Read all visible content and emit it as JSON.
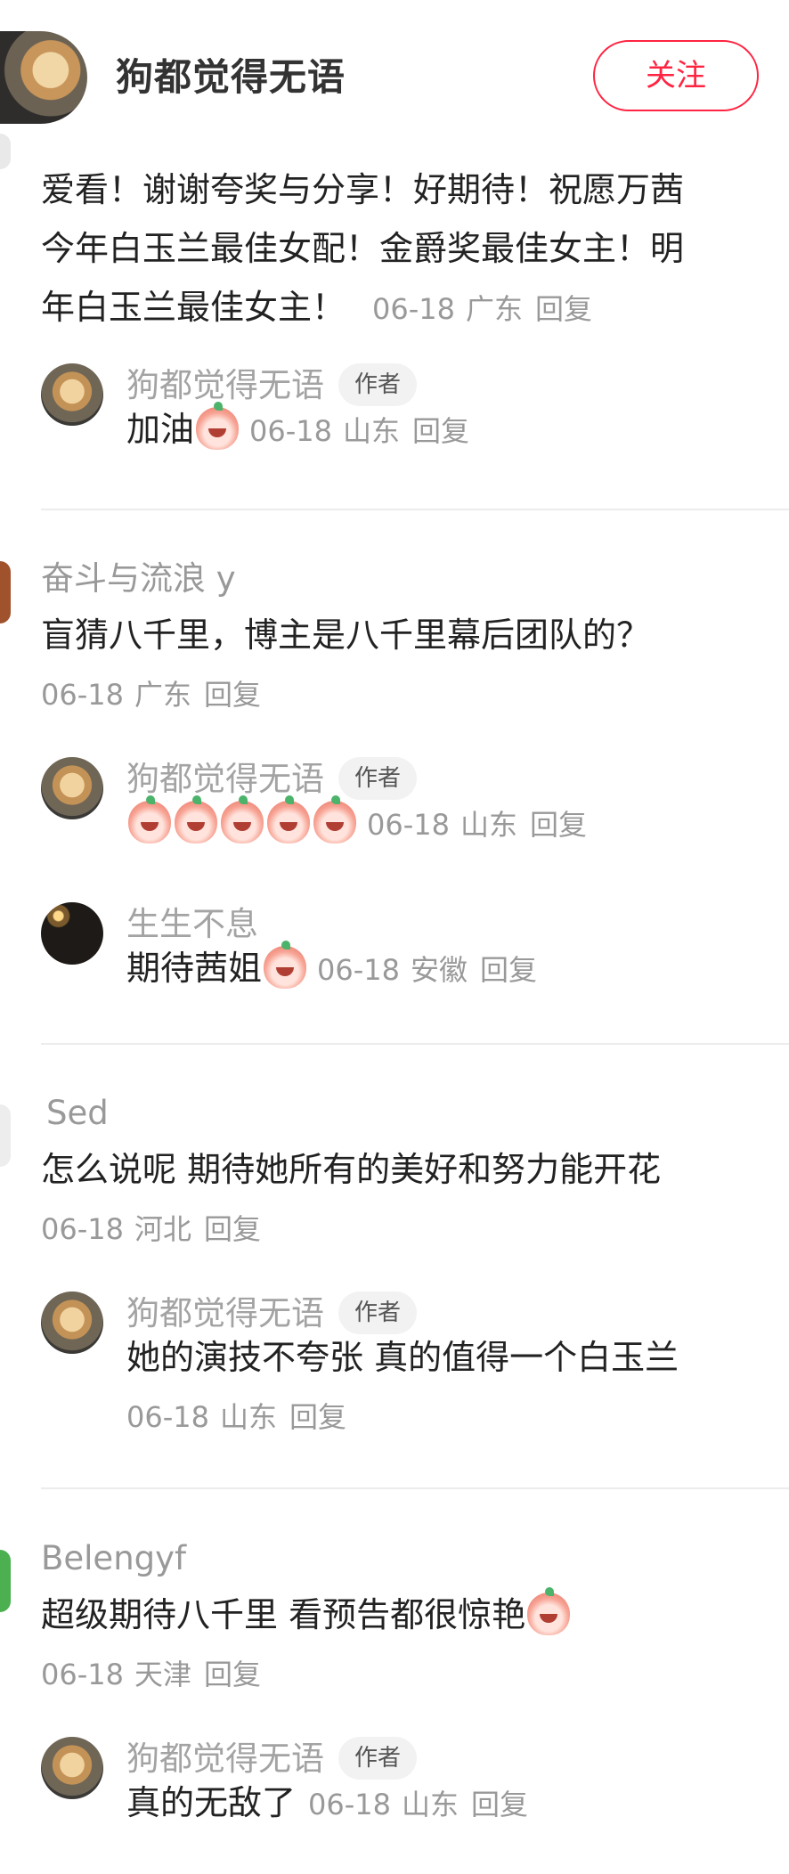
{
  "header": {
    "author_name": "狗都觉得无语",
    "follow_label": "关注"
  },
  "comments": [
    {
      "text": "爱看！谢谢夸奖与分享！好期待！祝愿万茜今年白玉兰最佳女配！金爵奖最佳女主！明年白玉兰最佳女主！",
      "line1": "爱看！谢谢夸奖与分享！好期待！祝愿万茜",
      "line2": "今年白玉兰最佳女配！金爵奖最佳女主！明",
      "line3": "年白玉兰最佳女主！",
      "date": "06-18",
      "location": "广东",
      "reply_label": "回复",
      "replies": [
        {
          "name": "狗都觉得无语",
          "badge": "作者",
          "text": "加油",
          "emoji_count": 1,
          "date": "06-18",
          "location": "山东",
          "reply_label": "回复"
        }
      ]
    },
    {
      "name": "奋斗与流浪 y",
      "text": "盲猜八千里，博主是八千里幕后团队的？",
      "date": "06-18",
      "location": "广东",
      "reply_label": "回复",
      "replies": [
        {
          "name": "狗都觉得无语",
          "badge": "作者",
          "text": "",
          "emoji_count": 5,
          "date": "06-18",
          "location": "山东",
          "reply_label": "回复"
        },
        {
          "name": "生生不息",
          "text": "期待茜姐",
          "emoji_count": 1,
          "date": "06-18",
          "location": "安徽",
          "reply_label": "回复"
        }
      ]
    },
    {
      "name": "Sed",
      "text": "怎么说呢 期待她所有的美好和努力能开花",
      "date": "06-18",
      "location": "河北",
      "reply_label": "回复",
      "replies": [
        {
          "name": "狗都觉得无语",
          "badge": "作者",
          "text": "她的演技不夸张 真的值得一个白玉兰",
          "date": "06-18",
          "location": "山东",
          "reply_label": "回复"
        }
      ]
    },
    {
      "name": "Belengyf",
      "text": "超级期待八千里 看预告都很惊艳",
      "emoji_count": 1,
      "date": "06-18",
      "location": "天津",
      "reply_label": "回复",
      "replies": [
        {
          "name": "狗都觉得无语",
          "badge": "作者",
          "text": "真的无敌了",
          "date": "06-18",
          "location": "山东",
          "reply_label": "回复"
        }
      ]
    }
  ],
  "colors": {
    "accent": "#ff2442",
    "muted_text": "#999999",
    "body_text": "#222222",
    "badge_bg": "#f2f2f2",
    "divider": "#ececec"
  },
  "icons": {
    "emoji": "peach-face-emoji",
    "avatar_author": "golden-retriever-avatar",
    "avatar_night": "streetlamp-night-avatar"
  }
}
